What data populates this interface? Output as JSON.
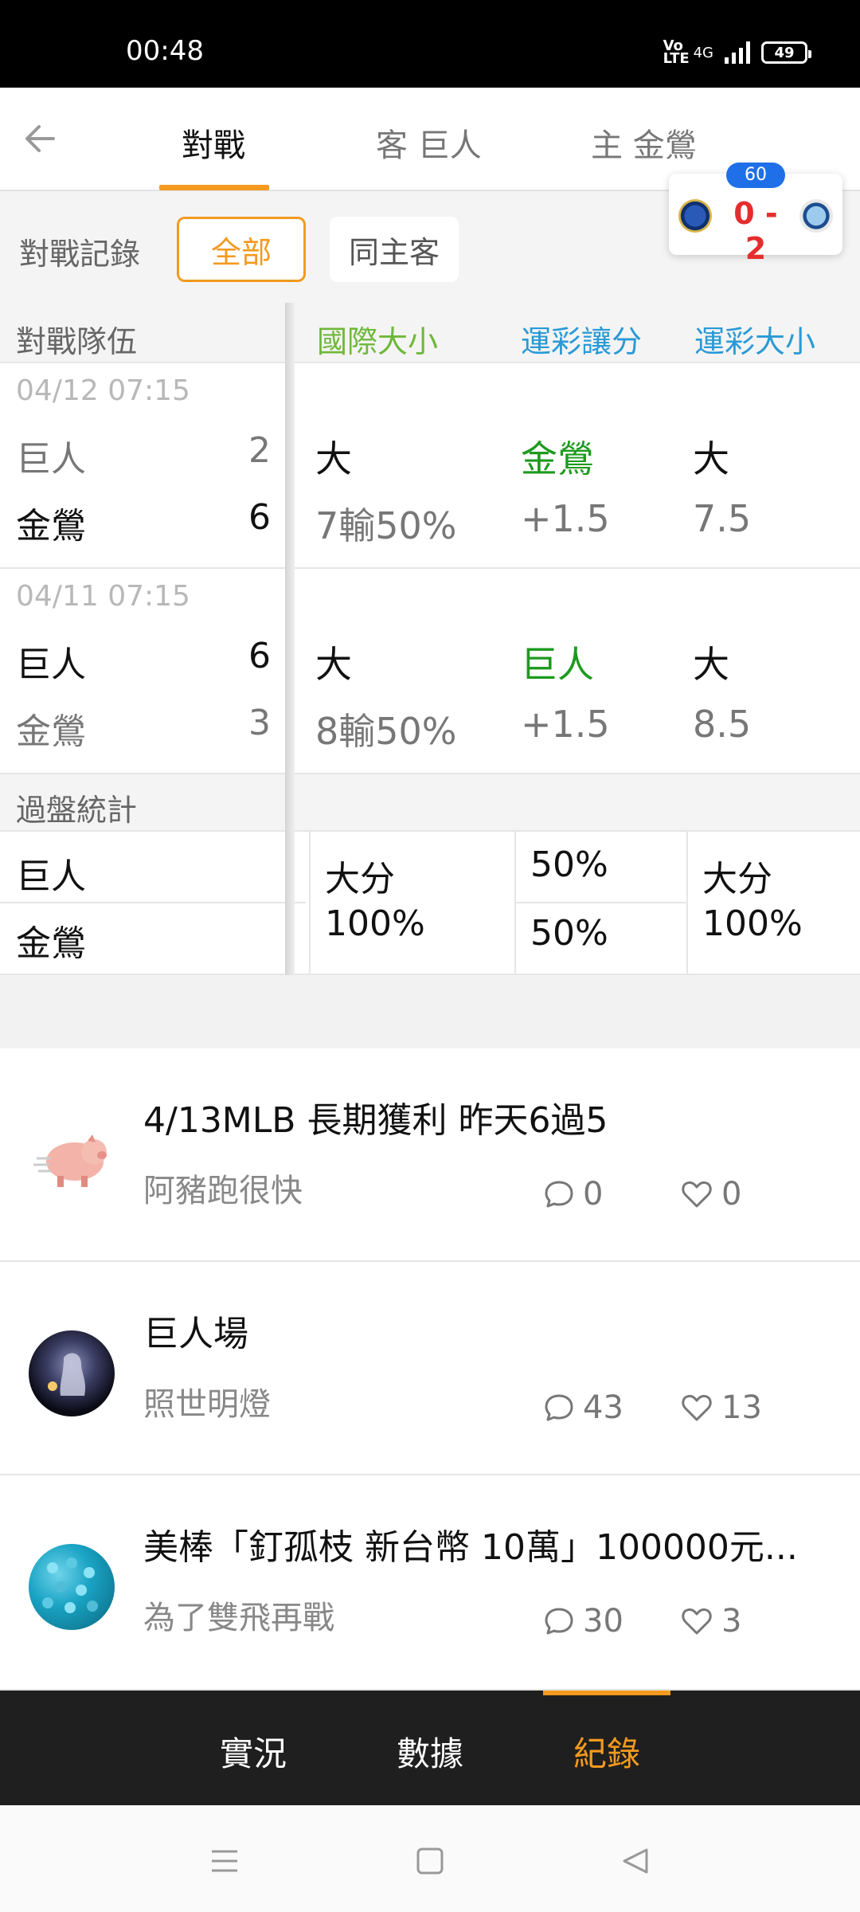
{
  "status_bar": {
    "time": "00:48",
    "volte": "Vo LTE",
    "network": "4G",
    "battery": "49"
  },
  "nav": {
    "tabs": [
      {
        "label": "對戰"
      },
      {
        "label": "客 巨人"
      },
      {
        "label": "主 金鶯"
      }
    ]
  },
  "score_card": {
    "minute": "60",
    "score": "0 - 2"
  },
  "filter": {
    "label": "對戰記錄",
    "options": [
      "全部",
      "同主客"
    ],
    "selected": "全部"
  },
  "table": {
    "headers": [
      "對戰隊伍",
      "國際大小",
      "運彩讓分",
      "運彩大小"
    ],
    "header_colors": [
      "#666666",
      "#6fb83a",
      "#2a9ad6",
      "#2a9ad6"
    ],
    "matches": [
      {
        "date": "04/12 07:15",
        "away_team": "巨人",
        "away_score": "2",
        "home_team": "金鶯",
        "home_score": "6",
        "intl_result": "大",
        "intl_detail": "7輸50%",
        "spread_winner": "金鶯",
        "spread_value": "+1.5",
        "ou_result": "大",
        "ou_value": "7.5"
      },
      {
        "date": "04/11 07:15",
        "away_team": "巨人",
        "away_score": "6",
        "home_team": "金鶯",
        "home_score": "3",
        "intl_result": "大",
        "intl_detail": "8輸50%",
        "spread_winner": "巨人",
        "spread_value": "+1.5",
        "ou_result": "大",
        "ou_value": "8.5"
      }
    ],
    "stats": {
      "title": "過盤統計",
      "teams": [
        "巨人",
        "金鶯"
      ],
      "intl": "大分\n100%",
      "spread": [
        "50%",
        "50%"
      ],
      "ou": "大分\n100%"
    }
  },
  "posts": [
    {
      "title": "4/13MLB 長期獲利 昨天6過5",
      "author": "阿豬跑很快",
      "comments": "0",
      "likes": "0",
      "avatar": "pig-avatar"
    },
    {
      "title": "巨人場",
      "author": "照世明燈",
      "comments": "43",
      "likes": "13",
      "avatar": "lamp-avatar"
    },
    {
      "title": "美棒「釘孤枝 新台幣 10萬」100000元...",
      "author": "為了雙飛再戰",
      "comments": "30",
      "likes": "3",
      "avatar": "beads-avatar"
    }
  ],
  "bottom_tabs": {
    "items": [
      "實況",
      "數據",
      "紀錄"
    ],
    "active": "紀錄"
  },
  "colors": {
    "accent": "#f39a1f",
    "green": "#1e9a1e",
    "red": "#e52d2d",
    "blue": "#1f6fe8"
  }
}
